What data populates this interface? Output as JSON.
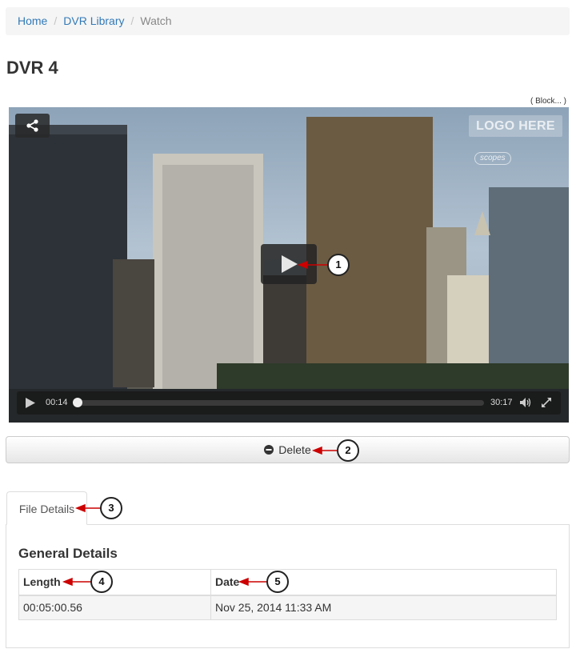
{
  "breadcrumb": {
    "home": "Home",
    "library": "DVR Library",
    "current": "Watch"
  },
  "page": {
    "title": "DVR 4"
  },
  "block_tag": "( Block... )",
  "player": {
    "logo_text": "LOGO HERE",
    "watermark": "scopes",
    "current_time": "00:14",
    "duration": "30:17",
    "progress_fraction": 0.008
  },
  "actions": {
    "delete_label": "Delete"
  },
  "tabs": [
    {
      "label": "File Details"
    }
  ],
  "details": {
    "section_title": "General Details",
    "headers": [
      "Length",
      "Date"
    ],
    "row": [
      "00:05:00.56",
      "Nov 25, 2014 11:33 AM"
    ]
  },
  "callouts": [
    "1",
    "2",
    "3",
    "4",
    "5"
  ],
  "colors": {
    "link": "#337ab7",
    "callout_arrow": "#cc0000"
  }
}
